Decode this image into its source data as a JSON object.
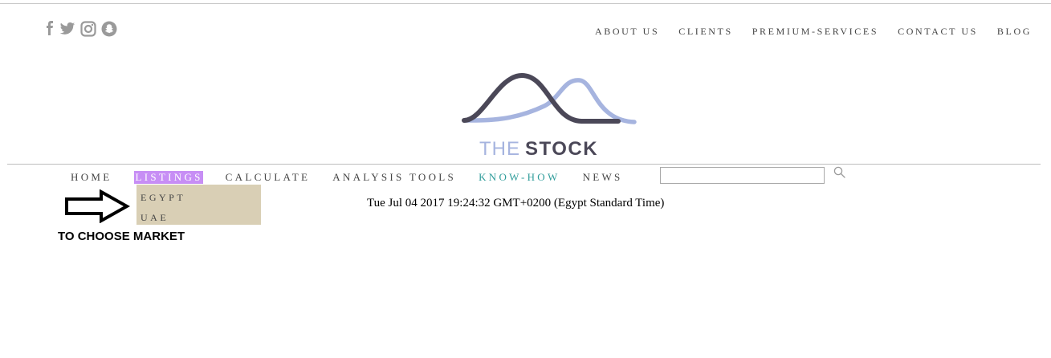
{
  "social": {
    "icons": [
      "facebook-icon",
      "twitter-icon",
      "instagram-icon",
      "snapchat-icon"
    ]
  },
  "top_nav": {
    "items": [
      "ABOUT US",
      "CLIENTS",
      "PREMIUM-SERVICES",
      "CONTACT US",
      "BLOG"
    ]
  },
  "brand": {
    "the": "THE",
    "stock": "STOCK",
    "colors": {
      "light": "#a6b4df",
      "dark": "#4b4858"
    }
  },
  "main_nav": {
    "items": [
      "HOME",
      "LISTINGS",
      "CALCULATE",
      "ANALYSIS TOOLS",
      "KNOW-HOW",
      "NEWS"
    ],
    "active": "LISTINGS",
    "active_color": "#c78ef5",
    "highlight_color": "#2e9c9a"
  },
  "search": {
    "value": "",
    "placeholder": "",
    "icon": "search-icon"
  },
  "dropdown": {
    "items": [
      "EGYPT",
      "UAE"
    ],
    "background": "#d9cfb5"
  },
  "datetime": "Tue Jul 04 2017 19:24:32 GMT+0200 (Egypt Standard Time)",
  "annotation": {
    "text": "TO CHOOSE MARKET",
    "icon": "right-arrow-icon"
  }
}
